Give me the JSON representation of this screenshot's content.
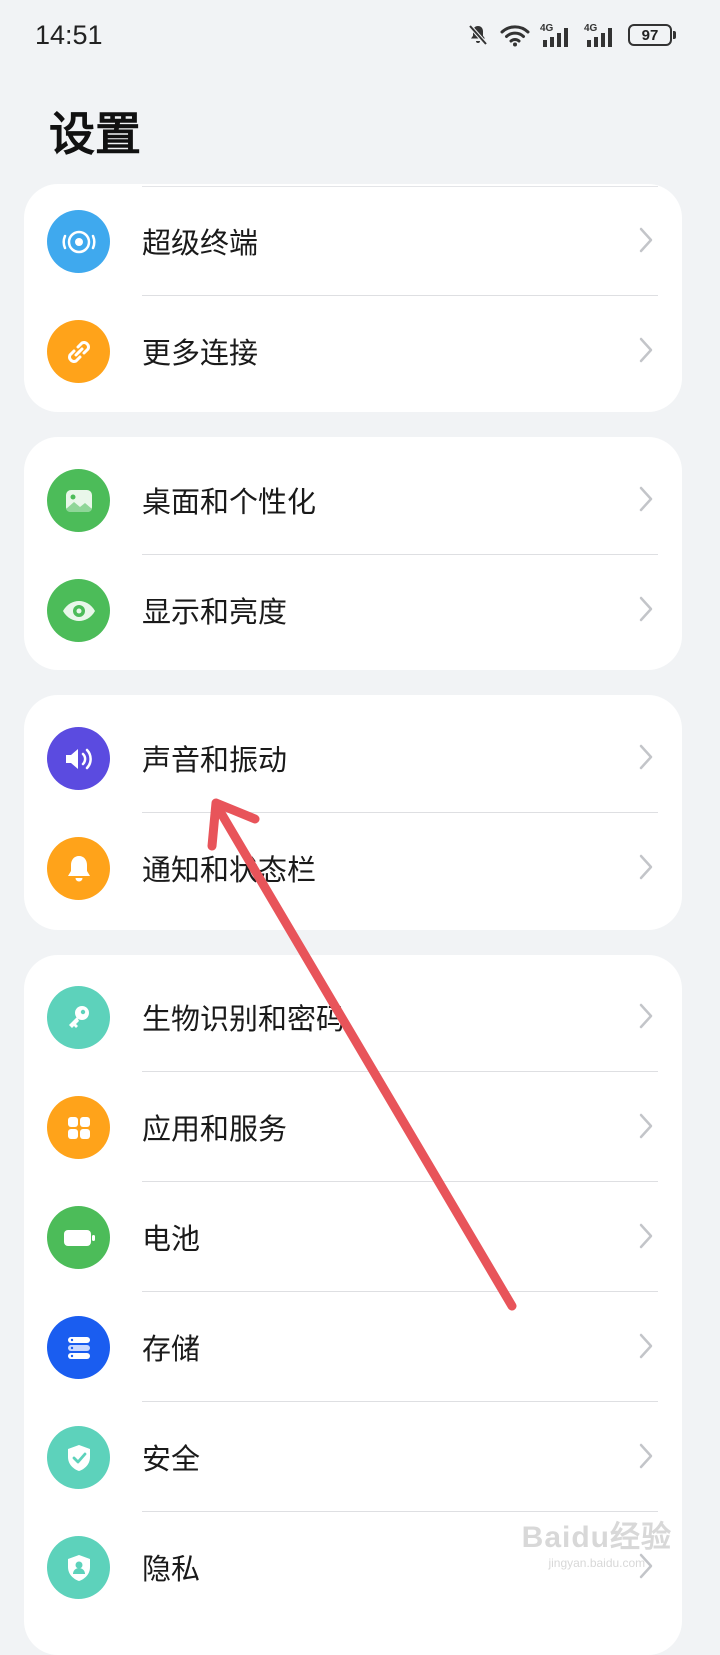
{
  "status_bar": {
    "time": "14:51",
    "network_1": "4G",
    "network_2": "4G",
    "battery": "97"
  },
  "page_title": "设置",
  "groups": [
    {
      "items": [
        {
          "label": "超级终端",
          "icon": "super-device-icon",
          "color": "#3fa9ee"
        },
        {
          "label": "更多连接",
          "icon": "link-icon",
          "color": "#ffa31a"
        }
      ]
    },
    {
      "items": [
        {
          "label": "桌面和个性化",
          "icon": "image-icon",
          "color": "#4cbc59"
        },
        {
          "label": "显示和亮度",
          "icon": "eye-icon",
          "color": "#4cbc59"
        }
      ]
    },
    {
      "items": [
        {
          "label": "声音和振动",
          "icon": "speaker-icon",
          "color": "#5b4be0"
        },
        {
          "label": "通知和状态栏",
          "icon": "bell-icon",
          "color": "#ffa31a"
        }
      ]
    },
    {
      "items": [
        {
          "label": "生物识别和密码",
          "icon": "key-icon",
          "color": "#5dd2bb"
        },
        {
          "label": "应用和服务",
          "icon": "apps-grid-icon",
          "color": "#ffa31a"
        },
        {
          "label": "电池",
          "icon": "battery-icon",
          "color": "#4cbc59"
        },
        {
          "label": "存储",
          "icon": "storage-icon",
          "color": "#1a5df0"
        },
        {
          "label": "安全",
          "icon": "shield-check-icon",
          "color": "#5dd2bb"
        },
        {
          "label": "隐私",
          "icon": "privacy-icon",
          "color": "#5dd2bb"
        }
      ]
    }
  ],
  "annotation_color": "#e8545a",
  "watermark": {
    "main": "Baidu经验",
    "sub": "jingyan.baidu.com"
  }
}
